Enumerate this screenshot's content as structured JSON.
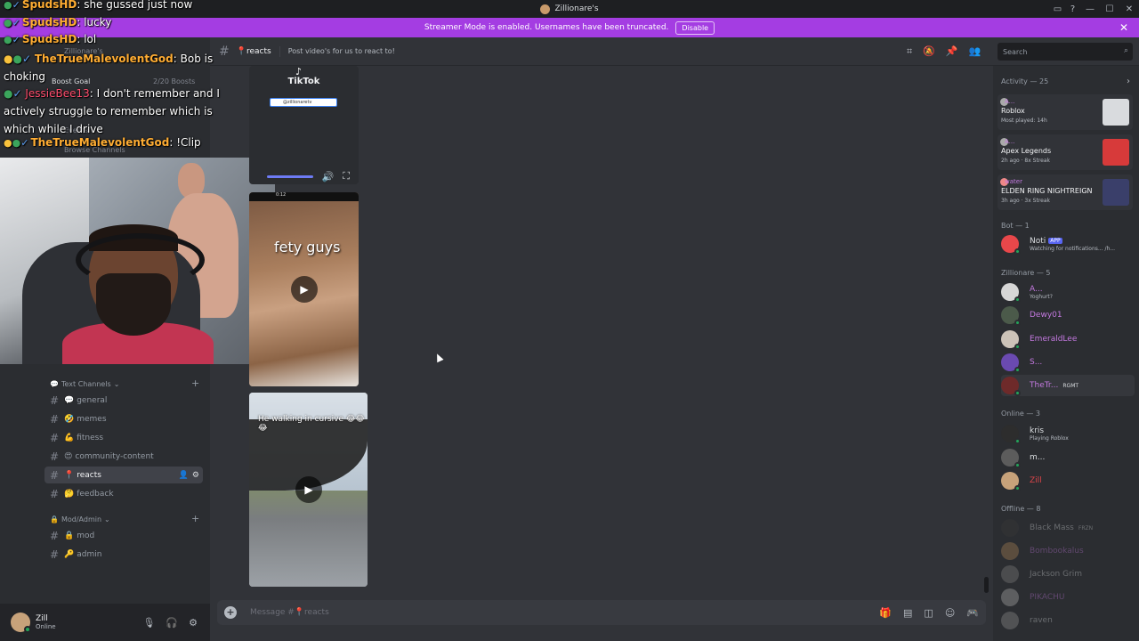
{
  "window": {
    "title": "Zillionare's"
  },
  "banner": {
    "text": "Streamer Mode is enabled. Usernames have been truncated.",
    "button": "Disable"
  },
  "sidebar": {
    "server_name": "Zillionare's",
    "boost_goal": "Boost Goal",
    "boosts": "2/20 Boosts",
    "ghost_items": [
      "Events",
      "Browse Channels"
    ],
    "categories": [
      {
        "label": "Text Channels",
        "channels": [
          {
            "emoji": "💬",
            "name": "general"
          },
          {
            "emoji": "🤣",
            "name": "memes"
          },
          {
            "emoji": "💪",
            "name": "fitness"
          },
          {
            "emoji": "😍",
            "name": "community-content"
          },
          {
            "emoji": "📍",
            "name": "reacts"
          },
          {
            "emoji": "🤔",
            "name": "feedback"
          }
        ]
      },
      {
        "label": "Mod/Admin",
        "channels": [
          {
            "emoji": "🔒",
            "name": "mod"
          },
          {
            "emoji": "🔑",
            "name": "admin"
          }
        ]
      }
    ]
  },
  "user": {
    "name": "Zill",
    "status": "Online"
  },
  "chat_overlay": [
    {
      "user": "SpudsHD",
      "text": "she gussed just now"
    },
    {
      "user": "SpudsHD",
      "text": "lucky"
    },
    {
      "user": "SpudsHD",
      "text": "lol"
    },
    {
      "user": "TheTrueMalevolentGod",
      "text": "Bob is choking"
    },
    {
      "user": "JessieBee13",
      "text": "I don't remember and I actively struggle to remember which is which while I drive"
    },
    {
      "user": "TheTrueMalevolentGod",
      "text": "!Clip"
    }
  ],
  "channel": {
    "name": "reacts",
    "emoji": "📍",
    "topic": "Post video's for us to react to!"
  },
  "search": {
    "placeholder": "Search"
  },
  "messages": {
    "tiktok": {
      "brand": "TikTok",
      "handle": "@zillionaretv"
    },
    "video2": {
      "overlay": "fety guys",
      "time": "0:12"
    },
    "video3": {
      "caption": "He walking in cursive 😂😂😂"
    }
  },
  "composer": {
    "placeholder": "Message #📍reacts"
  },
  "members": {
    "activity_header": "Activity — 25",
    "activities": [
      {
        "user": "A...",
        "game": "Roblox",
        "meta": "Most played: 14h",
        "color": "#d9dbde"
      },
      {
        "user": "A...",
        "game": "Apex Legends",
        "meta": "2h ago · 8x Streak",
        "color": "#d73a3a"
      },
      {
        "user": "water",
        "game": "ELDEN RING NIGHTREIGN",
        "meta": "3h ago · 3x Streak",
        "color": "#3a3f6a"
      }
    ],
    "groups": [
      {
        "header": "Bot — 1",
        "members": [
          {
            "name": "Noti",
            "badge": "APP",
            "status": "Watching for notifications... /h...",
            "color": "#dbdee1",
            "ava": "#e8474a"
          }
        ]
      },
      {
        "header": "Zillionare — 5",
        "members": [
          {
            "name": "A...",
            "status": "Yoghurt?",
            "color": "#c479e0",
            "ava": "#d7d7d7"
          },
          {
            "name": "Dewy01",
            "status": "",
            "color": "#c479e0",
            "ava": "#4b5a4a"
          },
          {
            "name": "EmeraldLee",
            "status": "",
            "color": "#c479e0",
            "ava": "#ccc3b8"
          },
          {
            "name": "S...",
            "status": "",
            "color": "#c479e0",
            "ava": "#6a4ab0"
          },
          {
            "name": "TheTr...",
            "badge": "RGMT",
            "status": "",
            "color": "#c479e0",
            "ava": "#6e2a2a"
          }
        ]
      },
      {
        "header": "Online — 3",
        "members": [
          {
            "name": "kris",
            "status": "Playing Roblox",
            "color": "#dbdee1",
            "ava": "#2d2d2d"
          },
          {
            "name": "m...",
            "status": "",
            "color": "#dbdee1",
            "ava": "#5c5c5c"
          },
          {
            "name": "Zill",
            "status": "",
            "color": "#e0454a",
            "ava": "#c7a27a"
          }
        ]
      },
      {
        "header": "Offline — 8",
        "members": [
          {
            "name": "Black Mass",
            "badge": "FRZN",
            "status": "",
            "color": "#dbdee1",
            "ava": "#3a3a3a"
          },
          {
            "name": "Bombookalus",
            "status": "",
            "color": "#c479e0",
            "ava": "#b58a5a"
          },
          {
            "name": "Jackson Grim",
            "status": "",
            "color": "#dbdee1",
            "ava": "#888"
          },
          {
            "name": "PIKACHU",
            "status": "",
            "color": "#c479e0",
            "ava": "#bbb"
          },
          {
            "name": "raven",
            "status": "",
            "color": "#dbdee1",
            "ava": "#999"
          }
        ]
      }
    ]
  }
}
